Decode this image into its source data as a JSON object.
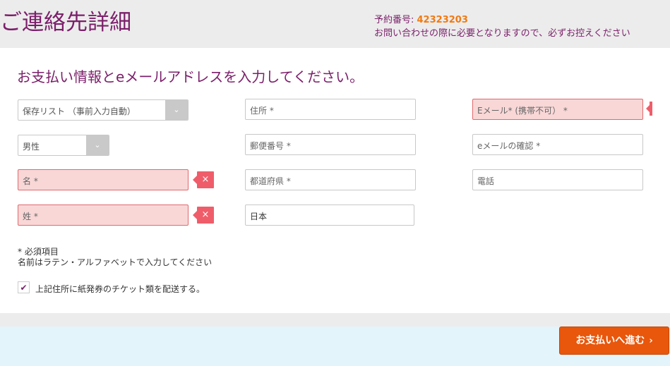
{
  "header": {
    "title": "ご連絡先詳細",
    "booking_label": "予約番号: ",
    "booking_number": "42323203",
    "booking_note": "お問い合わせの際に必要となりますので、必ずお控えください"
  },
  "form": {
    "title": "お支払い情報とeメールアドレスを入力してください。",
    "saved_list": {
      "value": "保存リスト （事前入力自動）"
    },
    "gender": {
      "value": "男性"
    },
    "first_name": {
      "placeholder": "名 *"
    },
    "last_name": {
      "placeholder": "姓 *"
    },
    "address": {
      "placeholder": "住所 *"
    },
    "postal_code": {
      "placeholder": "郵便番号 *"
    },
    "prefecture": {
      "placeholder": "都道府県 *"
    },
    "country": {
      "value": "日本"
    },
    "email": {
      "placeholder": "Eメール* (携帯不可） *"
    },
    "email_confirm": {
      "placeholder": "eメールの確認 *"
    },
    "phone": {
      "placeholder": "電話"
    },
    "clear_symbol": "×",
    "chevron_symbol": "⌄",
    "notes": {
      "required": "* 必須項目",
      "latin": "名前はラテン・アルファベットで入力してください"
    },
    "ship_checkbox": {
      "checked": true,
      "check_symbol": "✔",
      "label": "上記住所に紙発券のチケット類を配送する。"
    }
  },
  "footer": {
    "pay_button": "お支払いへ進む",
    "pay_chevron": "›"
  },
  "colors": {
    "brand": "#7b1f6a",
    "accent": "#f07a12",
    "button": "#e8570c",
    "error": "#ef5d6a",
    "error_bg": "#f9d7d7"
  }
}
